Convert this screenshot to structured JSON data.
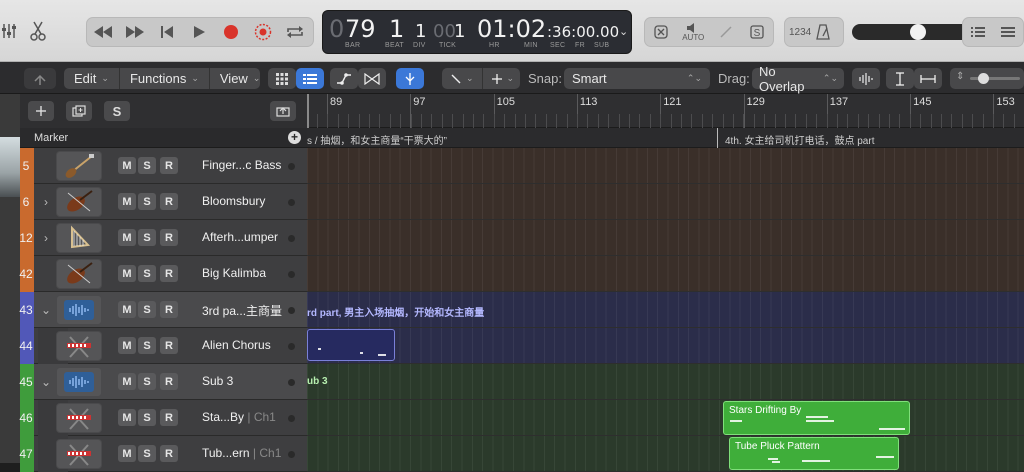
{
  "control_bar": {
    "transport_buttons": [
      "rewind-icon",
      "fast-forward-icon",
      "go-to-start-icon",
      "play-icon",
      "record-icon",
      "capture-record-icon",
      "cycle-icon"
    ],
    "lcd": {
      "bar": "79",
      "beat": "1",
      "div": "1",
      "tick": "1",
      "tick_prefix": "00",
      "time_main": "01:02",
      "time_rest": ":36:00.00",
      "labels": {
        "bar": "BAR",
        "beat": "BEAT",
        "div": "DIV",
        "tick": "TICK",
        "hr": "HR",
        "min": "MIN",
        "sec": "SEC",
        "fr": "FR",
        "sub": "SUB"
      }
    },
    "auto_label": "AUTO",
    "count_in_label": "1234"
  },
  "track_toolbar": {
    "menus": [
      "Edit",
      "Functions",
      "View"
    ],
    "snap_label": "Snap:",
    "snap_value": "Smart",
    "drag_label": "Drag:",
    "drag_value": "No Overlap"
  },
  "header": {
    "marker_label": "Marker",
    "s_button": "S"
  },
  "ruler": {
    "bars": [
      "89",
      "97",
      "105",
      "113",
      "121",
      "129",
      "137",
      "145",
      "153"
    ]
  },
  "markers": [
    {
      "text": "s / 抽烟，和女主商量“干票大的”"
    },
    {
      "text": "4th. 女主给司机打电话，鼓点 part"
    }
  ],
  "tracks": [
    {
      "num": "5",
      "name": "Finger...c Bass",
      "ch": "",
      "color": "#c96a2e",
      "icon": "bass-guitar-icon",
      "disclosure": ""
    },
    {
      "num": "6",
      "name": "Bloomsbury",
      "ch": "",
      "color": "#c96a2e",
      "icon": "violin-icon",
      "disclosure": ">"
    },
    {
      "num": "12",
      "name": "Afterh...umper",
      "ch": "",
      "color": "#c96a2e",
      "icon": "harp-icon",
      "disclosure": ">"
    },
    {
      "num": "42",
      "name": "Big Kalimba",
      "ch": "",
      "color": "#c96a2e",
      "icon": "violin-icon",
      "disclosure": ""
    },
    {
      "num": "43",
      "name": "3rd pa...主商量",
      "ch": "",
      "color": "#5158b8",
      "icon": "waveform-folder-icon",
      "disclosure": "v"
    },
    {
      "num": "44",
      "name": "Alien Chorus",
      "ch": "",
      "color": "#5158b8",
      "icon": "keyboard-stand-icon",
      "disclosure": ""
    },
    {
      "num": "45",
      "name": "Sub 3",
      "ch": "",
      "color": "#3f9c3c",
      "icon": "waveform-folder-icon",
      "disclosure": "v"
    },
    {
      "num": "46",
      "name": "Sta...By",
      "ch": " | Ch1",
      "color": "#3f9c3c",
      "icon": "keyboard-stand-icon",
      "disclosure": ""
    },
    {
      "num": "47",
      "name": "Tub...ern",
      "ch": " | Ch1",
      "color": "#3f9c3c",
      "icon": "keyboard-stand-icon",
      "disclosure": ""
    }
  ],
  "msr": [
    "M",
    "S",
    "R"
  ],
  "folder_labels": {
    "folder_43": "rd part, 男主入场抽烟，开始和女主商量",
    "folder_45": "ub 3"
  },
  "regions": {
    "stars": "Stars Drifting By",
    "tube": "Tube Pluck Pattern"
  },
  "colors": {
    "orange": "#c96a2e",
    "purple": "#5158b8",
    "green": "#3f9c3c",
    "region_green": "#3fae3a"
  }
}
